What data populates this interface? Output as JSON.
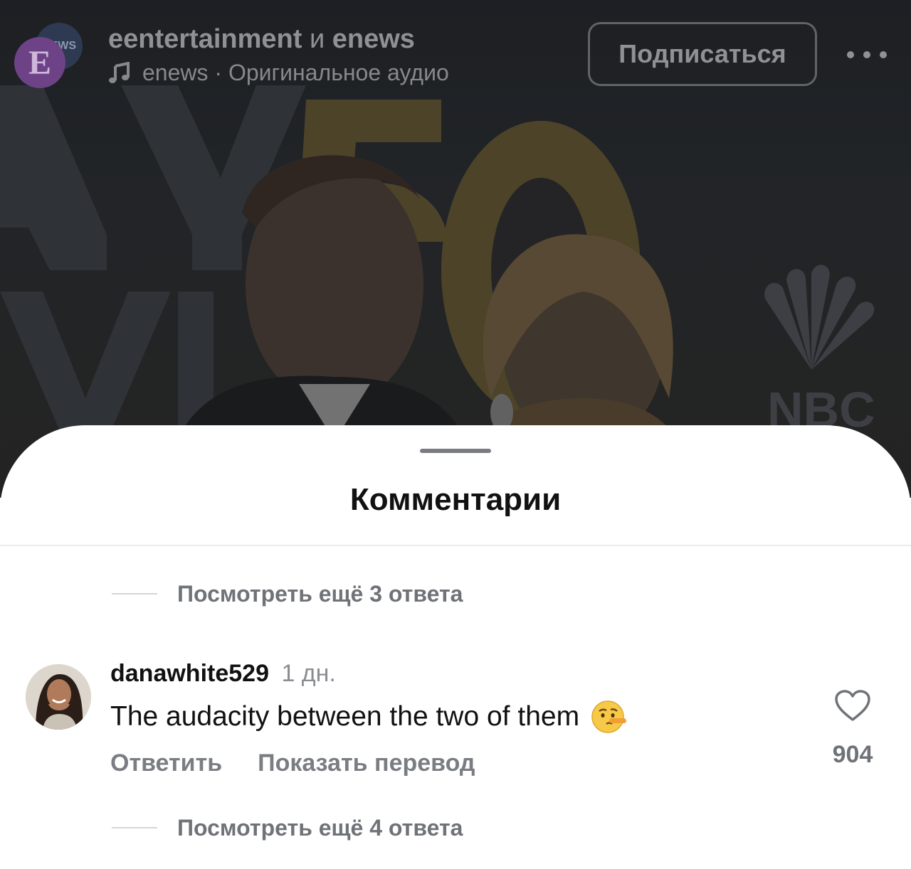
{
  "header": {
    "account_primary": "eentertainment",
    "joiner": "и",
    "account_secondary": "enews",
    "audio_label": "enews · Оригинальное аудио",
    "subscribe_label": "Подписаться",
    "avatar_letter": "E",
    "avatar_badge": "NEWS"
  },
  "sheet": {
    "title": "Комментарии",
    "replies_top": "Посмотреть ещё 3 ответа",
    "replies_bottom": "Посмотреть ещё 4 ответа"
  },
  "comment": {
    "username": "danawhite529",
    "time": "1 дн.",
    "text": "The audacity between the two of them",
    "emoji": "lying-face-icon",
    "reply_label": "Ответить",
    "translate_label": "Показать перевод",
    "like_count": "904"
  },
  "colors": {
    "sheet_bg": "#ffffff",
    "video_overlay": "#2a2c30",
    "muted_text": "#6f7378",
    "avatar_purple": "#6e4287"
  }
}
